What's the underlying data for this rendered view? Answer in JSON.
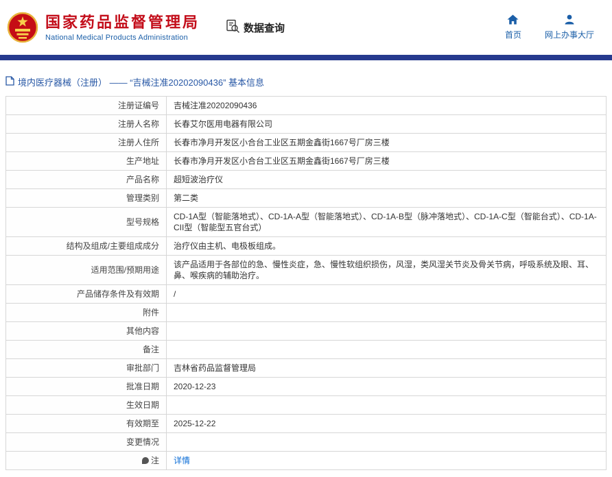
{
  "header": {
    "title": "国家药品监督管理局",
    "subtitle": "National Medical Products Administration",
    "data_query": "数据查询",
    "home": "首页",
    "service_hall": "网上办事大厅"
  },
  "breadcrumb": {
    "text": "境内医疗器械（注册） —— “吉械注准20202090436” 基本信息"
  },
  "colors": {
    "title_red": "#c30d1a",
    "nav_blue": "#1b5fa8",
    "bar_navy": "#263a8e",
    "link_blue": "#0a6cd6"
  },
  "table": {
    "rows": [
      {
        "label": "注册证编号",
        "value": "吉械注准20202090436"
      },
      {
        "label": "注册人名称",
        "value": "长春艾尔医用电器有限公司"
      },
      {
        "label": "注册人住所",
        "value": "长春市净月开发区小合台工业区五期金鑫街1667号厂房三楼"
      },
      {
        "label": "生产地址",
        "value": "长春市净月开发区小合台工业区五期金鑫街1667号厂房三楼"
      },
      {
        "label": "产品名称",
        "value": "超短波治疗仪"
      },
      {
        "label": "管理类别",
        "value": "第二类"
      },
      {
        "label": "型号规格",
        "value": "CD-1A型（智能落地式）、CD-1A-A型（智能落地式）、CD-1A-B型（脉冲落地式）、CD-1A-C型（智能台式）、CD-1A-CII型（智能型五官台式）"
      },
      {
        "label": "结构及组成/主要组成成分",
        "value": "治疗仪由主机、电极板组成。"
      },
      {
        "label": "适用范围/预期用途",
        "value": "该产品适用于各部位的急、慢性炎症，急、慢性软组织损伤，风湿，类风湿关节炎及骨关节病，呼吸系统及眼、耳、鼻、喉疾病的辅助治疗。"
      },
      {
        "label": "产品储存条件及有效期",
        "value": "/"
      },
      {
        "label": "附件",
        "value": ""
      },
      {
        "label": "其他内容",
        "value": ""
      },
      {
        "label": "备注",
        "value": ""
      },
      {
        "label": "审批部门",
        "value": "吉林省药品监督管理局"
      },
      {
        "label": "批准日期",
        "value": "2020-12-23"
      },
      {
        "label": "生效日期",
        "value": ""
      },
      {
        "label": "有效期至",
        "value": "2025-12-22"
      },
      {
        "label": "变更情况",
        "value": ""
      },
      {
        "label": "注",
        "value": "详情",
        "link": true,
        "icon": true
      }
    ]
  }
}
